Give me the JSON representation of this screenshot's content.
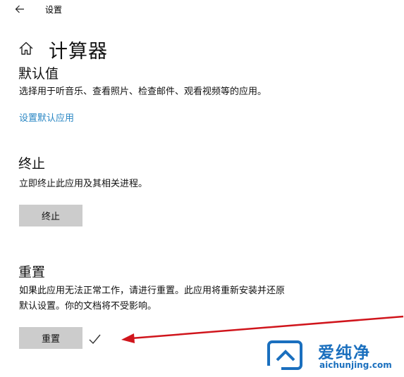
{
  "window": {
    "title": "设置"
  },
  "page": {
    "title": "计算器"
  },
  "defaults_section": {
    "heading": "默认值",
    "description": "选择用于听音乐、查看照片、检查邮件、观看视频等的应用。",
    "link_label": "设置默认应用"
  },
  "terminate_section": {
    "heading": "终止",
    "description": "立即终止此应用及其相关进程。",
    "button_label": "终止"
  },
  "reset_section": {
    "heading": "重置",
    "description_line1": "如果此应用无法正常工作，请进行重置。此应用将重新安装并还原",
    "description_line2": "默认设置。你的文档将不受影响。",
    "button_label": "重置",
    "completed_icon": "checkmark-icon"
  },
  "annotation": {
    "arrow_color": "#d0151c",
    "icon": "red-arrow"
  },
  "watermark": {
    "cn": "爱纯净",
    "en": "aichunjing.com",
    "color": "#1a6fbe"
  },
  "icons": {
    "back": "back-arrow-icon",
    "home": "home-icon"
  }
}
